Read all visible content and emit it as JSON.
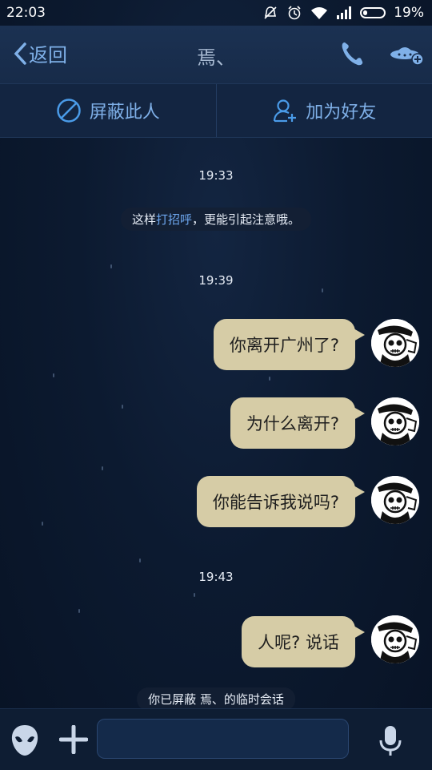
{
  "status_bar": {
    "time": "22:03",
    "battery_percent": "19%",
    "battery_level": 0.19
  },
  "header": {
    "back_label": "返回",
    "title": "焉、",
    "phone_icon": "phone-icon",
    "ufo_icon": "ufo-add-icon"
  },
  "actions": {
    "block_label": "屏蔽此人",
    "add_friend_label": "加为好友"
  },
  "chat": {
    "timestamps": [
      "19:33",
      "19:39",
      "19:43"
    ],
    "greeting_note": {
      "prefix": "这样",
      "link": "打招呼",
      "suffix": "，更能引起注意哦。"
    },
    "messages": [
      {
        "text": "你离开广州了?"
      },
      {
        "text": "为什么离开?"
      },
      {
        "text": "你能告诉我说吗?"
      },
      {
        "text": "人呢? 说话"
      }
    ],
    "blocked_note": "你已屏蔽 焉、的临时会话"
  },
  "input_bar": {
    "value": "",
    "placeholder": ""
  },
  "colors": {
    "accent": "#7fb0e8",
    "link": "#6ea8f0",
    "bubble": "#d6cca6",
    "background": "#0b1628"
  }
}
